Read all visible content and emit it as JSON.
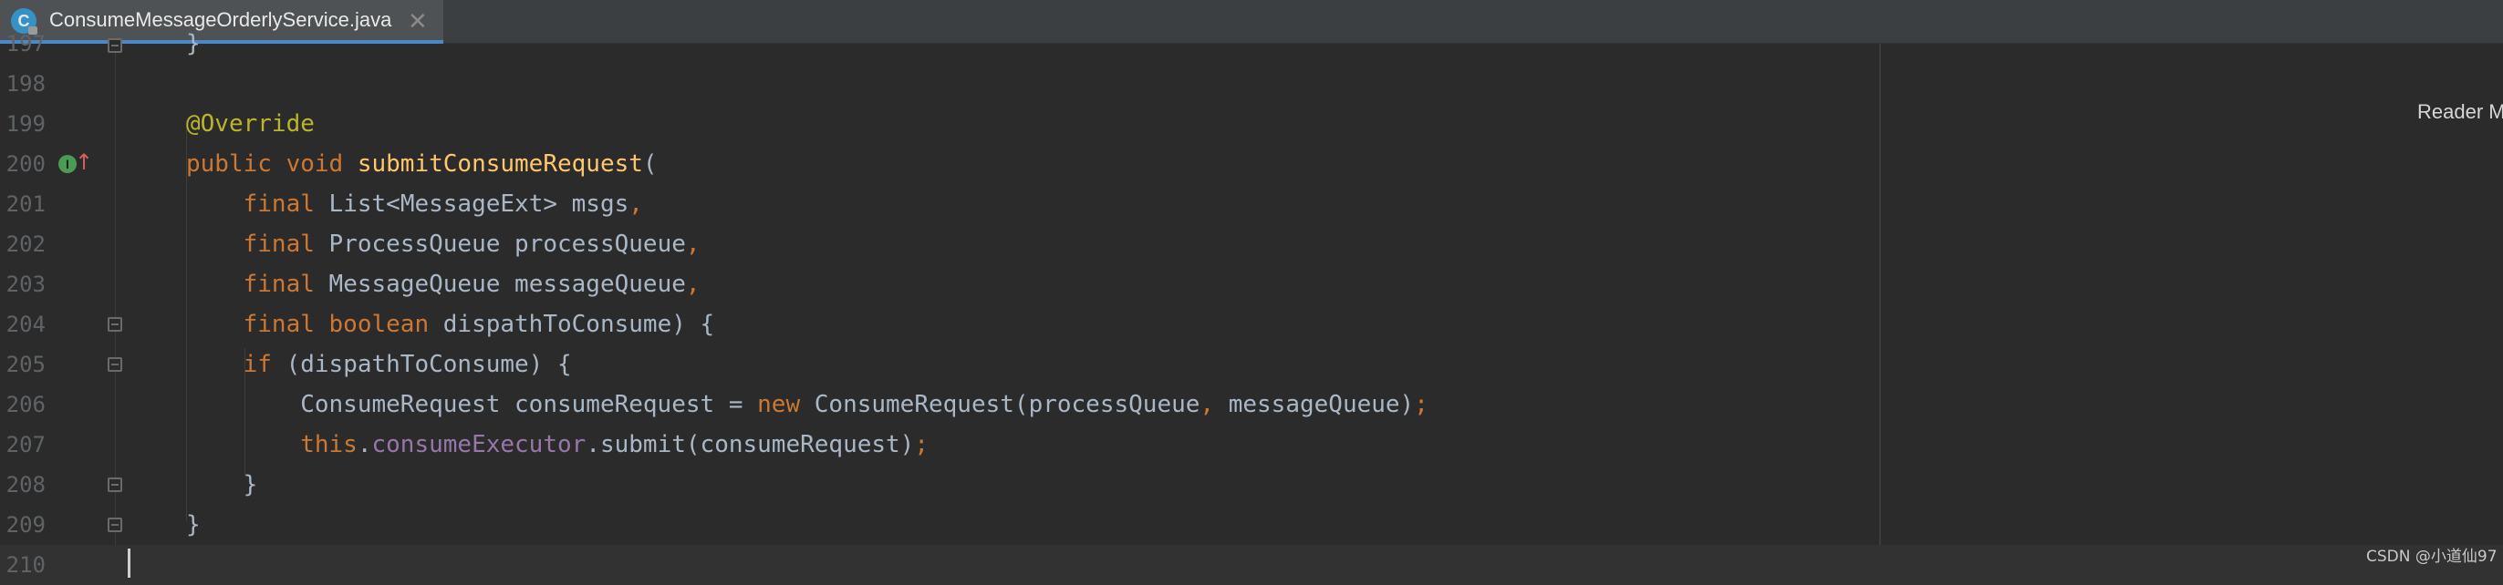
{
  "tab": {
    "title": "ConsumeMessageOrderlyService.java",
    "icon_letter": "C",
    "close_glyph": "✕"
  },
  "reader_mode": "Reader M",
  "watermark": "CSDN @小道仙97",
  "colors": {
    "background": "#2b2b2b",
    "keyword": "#cc7832",
    "annotation": "#bbb529",
    "method": "#ffc66d",
    "field": "#9876aa",
    "plain": "#a9b7c6",
    "line_number": "#606366"
  },
  "lines": [
    {
      "num": "197",
      "tokens": [
        {
          "t": "}",
          "c": "pl"
        }
      ]
    },
    {
      "num": "198",
      "tokens": []
    },
    {
      "num": "199",
      "tokens": [
        {
          "t": "@Override",
          "c": "ann"
        }
      ]
    },
    {
      "num": "200",
      "tokens": [
        {
          "t": "public void ",
          "c": "kw"
        },
        {
          "t": "submitConsumeRequest",
          "c": "fn"
        },
        {
          "t": "(",
          "c": "pl"
        }
      ]
    },
    {
      "num": "201",
      "tokens": [
        {
          "t": "    final ",
          "c": "kw"
        },
        {
          "t": "List<MessageExt> msgs",
          "c": "pl"
        },
        {
          "t": ",",
          "c": "kw"
        }
      ]
    },
    {
      "num": "202",
      "tokens": [
        {
          "t": "    final ",
          "c": "kw"
        },
        {
          "t": "ProcessQueue processQueue",
          "c": "pl"
        },
        {
          "t": ",",
          "c": "kw"
        }
      ]
    },
    {
      "num": "203",
      "tokens": [
        {
          "t": "    final ",
          "c": "kw"
        },
        {
          "t": "MessageQueue messageQueue",
          "c": "pl"
        },
        {
          "t": ",",
          "c": "kw"
        }
      ]
    },
    {
      "num": "204",
      "tokens": [
        {
          "t": "    final boolean ",
          "c": "kw"
        },
        {
          "t": "dispathToConsume) {",
          "c": "pl"
        }
      ]
    },
    {
      "num": "205",
      "tokens": [
        {
          "t": "    if ",
          "c": "kw"
        },
        {
          "t": "(dispathToConsume) {",
          "c": "pl"
        }
      ]
    },
    {
      "num": "206",
      "tokens": [
        {
          "t": "        ConsumeRequest consumeRequest = ",
          "c": "pl"
        },
        {
          "t": "new ",
          "c": "kw"
        },
        {
          "t": "ConsumeRequest(processQueue",
          "c": "pl"
        },
        {
          "t": ", ",
          "c": "kw"
        },
        {
          "t": "messageQueue)",
          "c": "pl"
        },
        {
          "t": ";",
          "c": "kw"
        }
      ]
    },
    {
      "num": "207",
      "tokens": [
        {
          "t": "        this",
          "c": "kw"
        },
        {
          "t": ".",
          "c": "pl"
        },
        {
          "t": "consumeExecutor",
          "c": "fld"
        },
        {
          "t": ".submit(consumeRequest)",
          "c": "pl"
        },
        {
          "t": ";",
          "c": "kw"
        }
      ]
    },
    {
      "num": "208",
      "tokens": [
        {
          "t": "    }",
          "c": "pl"
        }
      ]
    },
    {
      "num": "209",
      "tokens": [
        {
          "t": "}",
          "c": "pl"
        }
      ]
    },
    {
      "num": "210",
      "tokens": []
    }
  ]
}
